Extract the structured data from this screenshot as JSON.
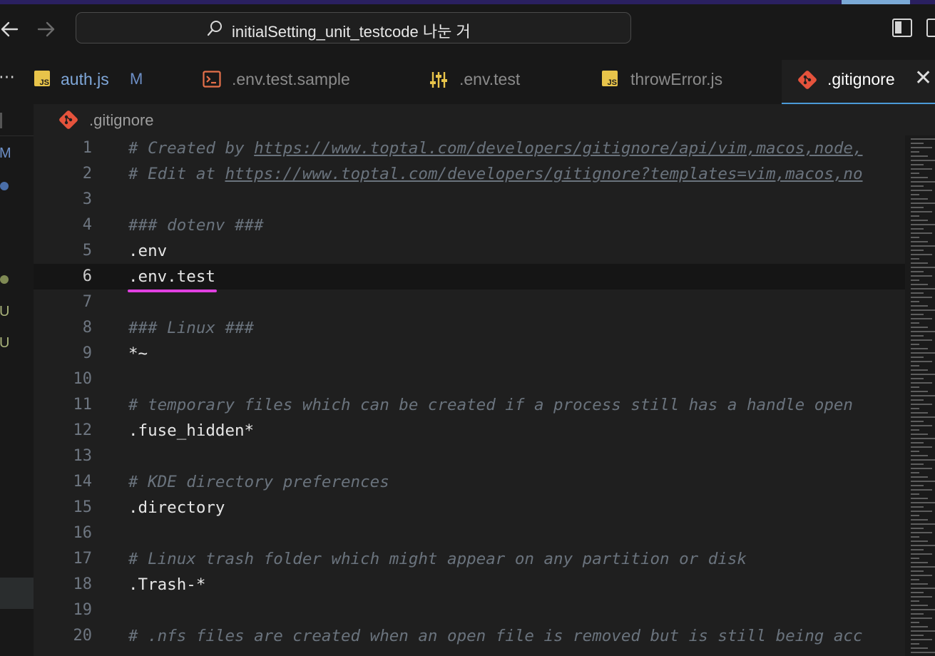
{
  "titlebar": {
    "back_icon": "arrow-left-icon",
    "forward_icon": "arrow-right-icon",
    "search_text": "initialSetting_unit_testcode 나눈 거",
    "layout_icon": "sidebar-layout-icon"
  },
  "tabs": [
    {
      "label": "auth.js",
      "icon": "js-file-icon",
      "status": "M",
      "color": "#7fa7d9"
    },
    {
      "label": ".env.test.sample",
      "icon": "terminal-icon",
      "color": "#8b8b8b"
    },
    {
      "label": ".env.test",
      "icon": "settings-sliders-icon",
      "color": "#8b8b8b"
    },
    {
      "label": "throwError.js",
      "icon": "js-file-icon",
      "color": "#8b8b8b"
    },
    {
      "label": ".gitignore",
      "icon": "git-icon",
      "color": "#ffffff",
      "active": true
    }
  ],
  "sidebar": {
    "markers": [
      {
        "text": "M",
        "color": "#6d8fc6"
      },
      {
        "text": "U",
        "color": "#a8b27a"
      },
      {
        "text": "U",
        "color": "#a8b27a"
      }
    ]
  },
  "breadcrumb": {
    "file": ".gitignore",
    "icon": "git-icon"
  },
  "editor": {
    "current_line": 6,
    "lines": [
      {
        "n": "1",
        "text": "# Created by https://www.toptal.com/developers/gitignore/api/vim,macos,node,",
        "type": "comment-link"
      },
      {
        "n": "2",
        "text": "# Edit at https://www.toptal.com/developers/gitignore?templates=vim,macos,no",
        "type": "comment-link"
      },
      {
        "n": "3",
        "text": "",
        "type": "plain"
      },
      {
        "n": "4",
        "text": "### dotenv ###",
        "type": "comment"
      },
      {
        "n": "5",
        "text": ".env",
        "type": "plain"
      },
      {
        "n": "6",
        "text": ".env.test",
        "type": "plain"
      },
      {
        "n": "7",
        "text": "",
        "type": "plain"
      },
      {
        "n": "8",
        "text": "### Linux ###",
        "type": "comment"
      },
      {
        "n": "9",
        "text": "*~",
        "type": "plain"
      },
      {
        "n": "10",
        "text": "",
        "type": "plain"
      },
      {
        "n": "11",
        "text": "# temporary files which can be created if a process still has a handle open",
        "type": "comment"
      },
      {
        "n": "12",
        "text": ".fuse_hidden*",
        "type": "plain"
      },
      {
        "n": "13",
        "text": "",
        "type": "plain"
      },
      {
        "n": "14",
        "text": "# KDE directory preferences",
        "type": "comment"
      },
      {
        "n": "15",
        "text": ".directory",
        "type": "plain"
      },
      {
        "n": "16",
        "text": "",
        "type": "plain"
      },
      {
        "n": "17",
        "text": "# Linux trash folder which might appear on any partition or disk",
        "type": "comment"
      },
      {
        "n": "18",
        "text": ".Trash-*",
        "type": "plain"
      },
      {
        "n": "19",
        "text": "",
        "type": "plain"
      },
      {
        "n": "20",
        "text": "# .nfs files are created when an open file is removed but is still being acc",
        "type": "comment"
      }
    ]
  }
}
